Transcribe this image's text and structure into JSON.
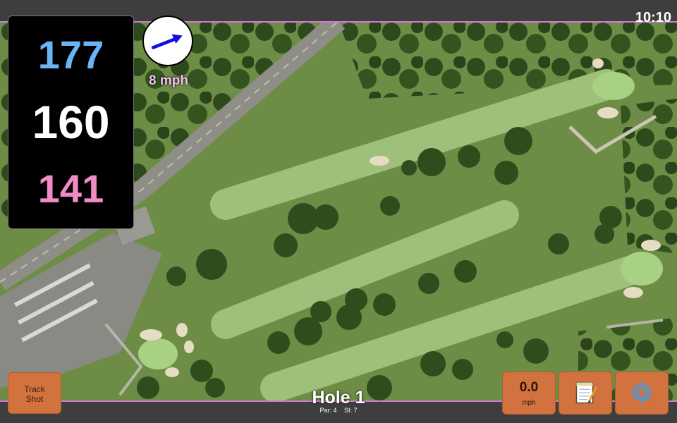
{
  "status_bar": {
    "time": "10:10"
  },
  "yardage": {
    "back": "177",
    "middle": "160",
    "front": "141"
  },
  "wind": {
    "speed": "8 mph",
    "icon": "wind-direction-arrow-icon",
    "arrow_color": "#1010e0"
  },
  "buttons": {
    "track_shot": "Track\nShot",
    "speed_value": "0.0",
    "speed_unit": "mph",
    "notes_icon": "notepad-icon",
    "settings_icon": "gear-icon"
  },
  "hole": {
    "title": "Hole 1",
    "par": "Par: 4",
    "si": "SI: 7"
  },
  "colors": {
    "back_yardage": "#6ab4f5",
    "middle_yardage": "#ffffff",
    "front_yardage": "#f08cc4",
    "button": "#d2723f"
  }
}
